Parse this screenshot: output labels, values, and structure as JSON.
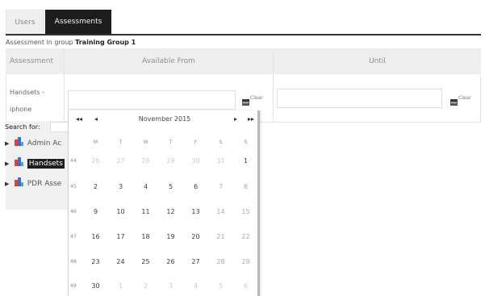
{
  "tabs": [
    {
      "label": "Users",
      "active": false
    },
    {
      "label": "Assessments",
      "active": true
    }
  ],
  "group_heading": {
    "prefix": "Assessment in group",
    "name": "Training Group 1"
  },
  "table": {
    "headers": [
      "Assessment",
      "Available From",
      "Until"
    ],
    "row": {
      "label": "Handsets - iphone",
      "available_from": "",
      "until": "",
      "clear_label": "Clear"
    }
  },
  "search": {
    "label": "Search for:",
    "value": ""
  },
  "tree": [
    {
      "label": "Admin Ac",
      "selected": false
    },
    {
      "label": "Handsets",
      "selected": true
    },
    {
      "label": "PDR Asse",
      "selected": false
    }
  ],
  "calendar": {
    "month_label": "November 2015",
    "nav": {
      "prev_year": "◂◂",
      "prev": "◂",
      "next": "▸",
      "next_year": "▸▸"
    },
    "weekdays": [
      "M",
      "T",
      "W",
      "T",
      "F",
      "S",
      "S"
    ],
    "weeks": [
      {
        "week": "44",
        "days": [
          [
            "26",
            "out"
          ],
          [
            "27",
            "out"
          ],
          [
            "28",
            "out"
          ],
          [
            "29",
            "out"
          ],
          [
            "30",
            "out"
          ],
          [
            "31",
            "out"
          ],
          [
            "1",
            "in"
          ]
        ]
      },
      {
        "week": "45",
        "days": [
          [
            "2",
            "in"
          ],
          [
            "3",
            "in"
          ],
          [
            "4",
            "in"
          ],
          [
            "5",
            "in"
          ],
          [
            "6",
            "in"
          ],
          [
            "7",
            "wkend"
          ],
          [
            "8",
            "wkend"
          ]
        ]
      },
      {
        "week": "46",
        "days": [
          [
            "9",
            "in"
          ],
          [
            "10",
            "in"
          ],
          [
            "11",
            "in"
          ],
          [
            "12",
            "in"
          ],
          [
            "13",
            "in"
          ],
          [
            "14",
            "wkend"
          ],
          [
            "15",
            "wkend"
          ]
        ]
      },
      {
        "week": "47",
        "days": [
          [
            "16",
            "in"
          ],
          [
            "17",
            "in"
          ],
          [
            "18",
            "in"
          ],
          [
            "19",
            "in"
          ],
          [
            "20",
            "in"
          ],
          [
            "21",
            "wkend"
          ],
          [
            "22",
            "wkend"
          ]
        ]
      },
      {
        "week": "48",
        "days": [
          [
            "23",
            "in"
          ],
          [
            "24",
            "in"
          ],
          [
            "25",
            "in"
          ],
          [
            "26",
            "in"
          ],
          [
            "27",
            "in"
          ],
          [
            "28",
            "wkend"
          ],
          [
            "29",
            "wkend"
          ]
        ]
      },
      {
        "week": "49",
        "days": [
          [
            "30",
            "in"
          ],
          [
            "1",
            "out"
          ],
          [
            "2",
            "out"
          ],
          [
            "3",
            "out"
          ],
          [
            "4",
            "out"
          ],
          [
            "5",
            "out"
          ],
          [
            "6",
            "out"
          ]
        ]
      }
    ]
  },
  "colors": {
    "tab_active_bg": "#1d1d1d",
    "header_bg": "#eeeeee",
    "selected_bg": "#1d1d1d"
  }
}
